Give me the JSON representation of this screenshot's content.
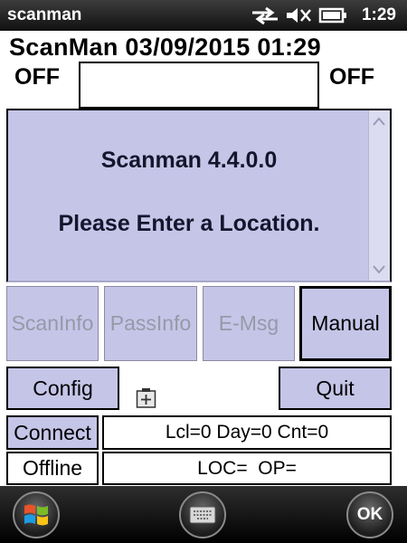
{
  "status_bar": {
    "app_title": "scanman",
    "time": "1:29",
    "icons": [
      "network-arrows-icon",
      "speaker-muted-icon",
      "battery-icon"
    ]
  },
  "header": {
    "title_line": "ScanMan 03/09/2015 01:29",
    "left_status": "OFF",
    "right_status": "OFF",
    "scan_input": {
      "value": "",
      "placeholder": ""
    }
  },
  "message_panel": {
    "title": "Scanman 4.4.0.0",
    "message": "Please Enter a Location."
  },
  "buttons": {
    "scaninfo": "ScanInfo",
    "passinfo": "PassInfo",
    "emsg": "E-Msg",
    "manual": "Manual",
    "config": "Config",
    "quit": "Quit",
    "connect": "Connect",
    "offline": "Offline"
  },
  "info": {
    "counts": "Lcl=0 Day=0 Cnt=0",
    "loc_op": "LOC=  OP="
  },
  "taskbar": {
    "ok_label": "OK",
    "icons": [
      "windows-start-icon",
      "keyboard-icon"
    ]
  },
  "colors": {
    "panel_bg": "#c5c5e8",
    "status_bar_bg": "#111111",
    "disabled_text": "#9898a8"
  }
}
